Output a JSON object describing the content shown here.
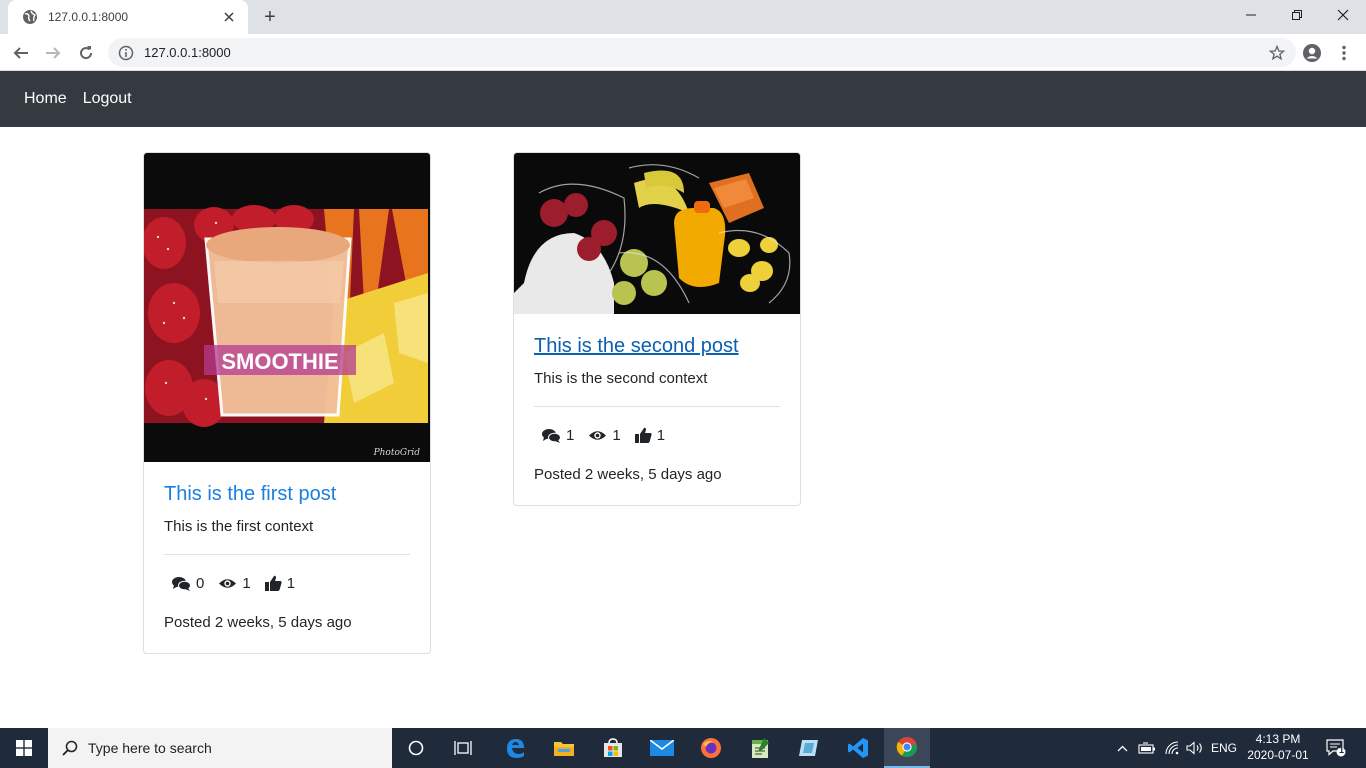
{
  "browser": {
    "tab_title": "127.0.0.1:8000",
    "new_tab_label": "+",
    "url": "127.0.0.1:8000"
  },
  "nav": {
    "home_label": "Home",
    "logout_label": "Logout"
  },
  "posts": [
    {
      "title": "This is the first post",
      "context": "This is the first context",
      "image_caption": "SMOOTHIE",
      "image_watermark": "PhotoGrid",
      "comments": "0",
      "views": "1",
      "likes": "1",
      "posted": "Posted 2 weeks, 5 days ago"
    },
    {
      "title": "This is the second post",
      "context": "This is the second context",
      "comments": "1",
      "views": "1",
      "likes": "1",
      "posted": "Posted 2 weeks, 5 days ago"
    }
  ],
  "taskbar": {
    "search_placeholder": "Type here to search",
    "language": "ENG",
    "time": "4:13 PM",
    "date": "2020-07-01",
    "notification_count": "1"
  },
  "colors": {
    "navbar_bg": "#343a40",
    "link": "#1a7fe0",
    "visited_link": "#0d5fb0",
    "taskbar_bg": "#1f2a3a"
  },
  "icons": [
    "globe-icon",
    "close-icon",
    "back-icon",
    "forward-icon",
    "reload-icon",
    "info-icon",
    "star-icon",
    "account-icon",
    "menu-icon",
    "comments-icon",
    "eye-icon",
    "thumbs-up-icon",
    "windows-start-icon",
    "search-icon",
    "cortana-icon",
    "task-view-icon",
    "edge-icon",
    "file-explorer-icon",
    "store-icon",
    "mail-icon",
    "firefox-icon",
    "notepad-icon",
    "app-icon",
    "vscode-icon",
    "chrome-icon"
  ]
}
